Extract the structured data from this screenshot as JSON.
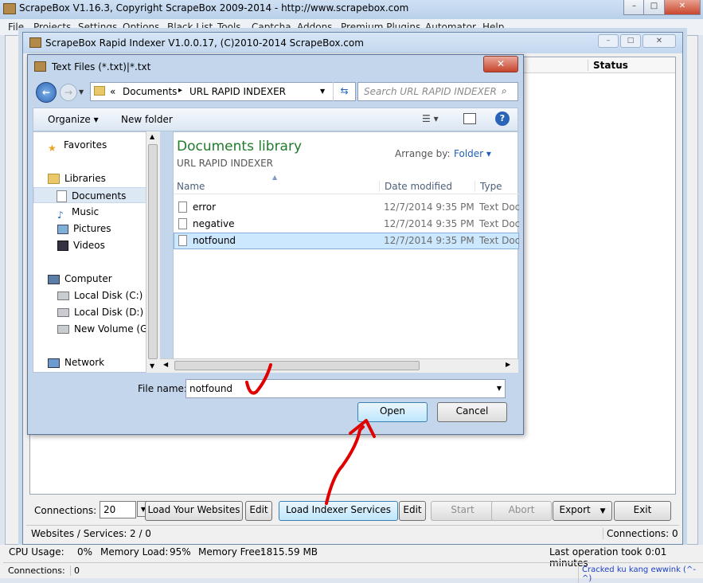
{
  "main_window": {
    "title": "ScrapeBox V1.16.3, Copyright ScrapeBox 2009-2014 - http://www.scrapebox.com",
    "menu": [
      "File",
      "Projects",
      "Settings",
      "Options",
      "Black List",
      "Tools",
      "Captcha",
      "Addons",
      "Premium Plugins",
      "Automator",
      "Help"
    ],
    "window_buttons": {
      "minimize": "–",
      "maximize": "□",
      "close": "✕"
    }
  },
  "indexer_window": {
    "title": "ScrapeBox Rapid Indexer V1.0.0.17, (C)2010-2014 ScrapeBox.com",
    "grid_header_status": "Status",
    "connections_label": "Connections:",
    "connections_value": "20",
    "load_websites_button": "Load Your Websites",
    "edit_button_1": "Edit",
    "load_indexer_button": "Load Indexer Services",
    "edit_button_2": "Edit",
    "start_button": "Start",
    "abort_button": "Abort",
    "export_button": "Export",
    "exit_button": "Exit",
    "websites_services_label": "Websites / Services:",
    "websites_services_value": "2 / 0",
    "connections_status": "Connections: 0"
  },
  "dialog": {
    "title": "Text Files (*.txt)|*.txt",
    "close": "✕",
    "address": {
      "chevron": "«",
      "part1": "Documents",
      "sep": "▸",
      "part2": "URL RAPID INDEXER"
    },
    "search_placeholder": "Search URL RAPID INDEXER",
    "organize_label": "Organize ▾",
    "new_folder_label": "New folder",
    "nav_items": [
      {
        "label": "Favorites",
        "icon": "star-icon"
      },
      {
        "label": "Libraries",
        "icon": "libraries-icon"
      },
      {
        "label": "Documents",
        "icon": "documents-icon",
        "selected": true
      },
      {
        "label": "Music",
        "icon": "music-icon"
      },
      {
        "label": "Pictures",
        "icon": "pictures-icon"
      },
      {
        "label": "Videos",
        "icon": "videos-icon"
      },
      {
        "label": "Computer",
        "icon": "computer-icon"
      },
      {
        "label": "Local Disk (C:)",
        "icon": "disk-icon"
      },
      {
        "label": "Local Disk (D:)",
        "icon": "disk-icon"
      },
      {
        "label": "New Volume (G:)",
        "icon": "disk-icon"
      },
      {
        "label": "Network",
        "icon": "network-icon"
      }
    ],
    "library_title": "Documents library",
    "library_subtitle": "URL RAPID INDEXER",
    "arrange_label": "Arrange by:",
    "arrange_value": "Folder ▾",
    "columns": [
      "Name",
      "Date modified",
      "Type"
    ],
    "files": [
      {
        "name": "error",
        "date": "12/7/2014 9:35 PM",
        "type": "Text Docu"
      },
      {
        "name": "negative",
        "date": "12/7/2014 9:35 PM",
        "type": "Text Docu"
      },
      {
        "name": "notfound",
        "date": "12/7/2014 9:35 PM",
        "type": "Text Docu",
        "selected": true
      }
    ],
    "file_name_label": "File name:",
    "file_name_value": "notfound",
    "open_button": "Open",
    "cancel_button": "Cancel"
  },
  "status_bar": {
    "cpu_label": "CPU Usage:",
    "cpu_value": "0%",
    "memload_label": "Memory Load:",
    "memload_value": "95%",
    "memfree_label": "Memory Free:",
    "memfree_value": "1815.59 MB",
    "last_op": "Last operation took 0:01 minutes",
    "connections_label": "Connections:",
    "connections_value": "0",
    "credit": "Cracked ku kang ewwink (^-^)"
  },
  "colors": {
    "library_title": "#1e7b2a",
    "credit": "#1b3fc9",
    "annotation": "#e00000",
    "selection": "#cce8ff"
  }
}
